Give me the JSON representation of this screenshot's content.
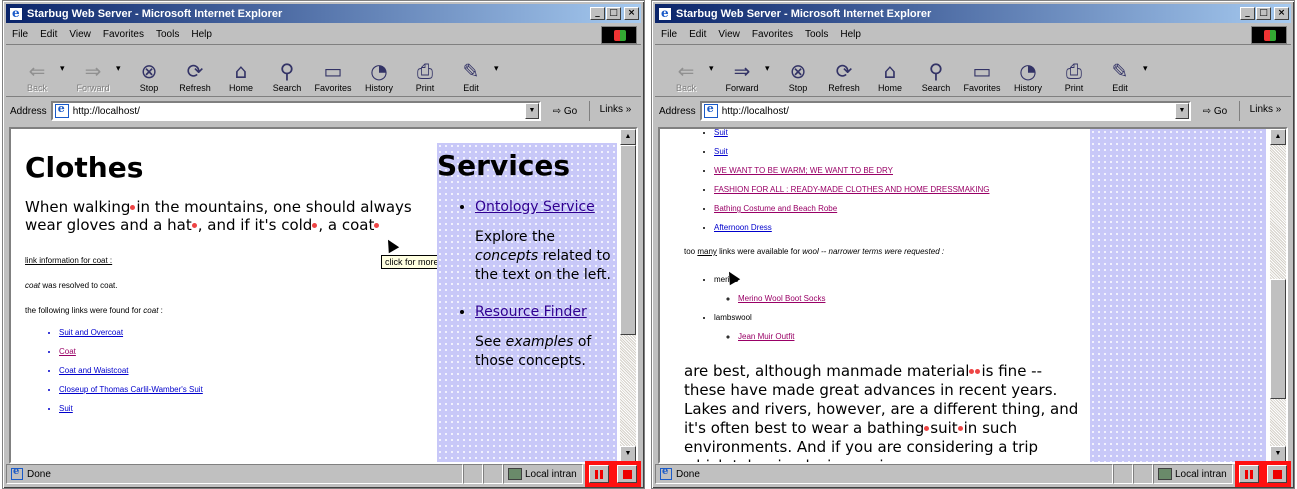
{
  "window": {
    "title": "Starbug Web Server - Microsoft Internet Explorer",
    "caption_min": "_",
    "caption_max": "□",
    "caption_close": "×"
  },
  "menu": [
    "File",
    "Edit",
    "View",
    "Favorites",
    "Tools",
    "Help"
  ],
  "toolbar": {
    "back": "Back",
    "forward": "Forward",
    "stop": "Stop",
    "refresh": "Refresh",
    "home": "Home",
    "search": "Search",
    "favorites": "Favorites",
    "history": "History",
    "print": "Print",
    "edit": "Edit"
  },
  "address": {
    "label": "Address",
    "url": "http://localhost/",
    "go": "Go",
    "links": "Links »"
  },
  "status": {
    "text": "Done",
    "zone": "Local intran"
  },
  "left_page": {
    "heading": "Clothes",
    "para_1": "When walking",
    "para_2": "in the mountains, one should always wear gloves and a hat",
    "para_3": ", and if it's cold",
    "para_4": ", a coat",
    "tooltip": "click for more info on 'coat'.",
    "info_heading": "link information for  coat :",
    "resolved_word": "coat",
    "resolved_text": " was resolved to  coat.",
    "found_prefix": "the following links were found for ",
    "found_word": "coat",
    "found_suffix": " :",
    "links": [
      "Suit and Overcoat",
      "Coat",
      "Coat and Waistcoat",
      "Closeup of Thomas Carlil-Wamber's Suit",
      "Suit"
    ],
    "services_heading": "Services",
    "service_1": "Ontology Service",
    "service_1_desc_a": "Explore the ",
    "service_1_desc_em": "concepts",
    "service_1_desc_b": " related to the text on the left.",
    "service_2": "Resource Finder",
    "service_2_desc_a": "See ",
    "service_2_desc_em": "examples",
    "service_2_desc_b": " of those concepts."
  },
  "right_page": {
    "links": [
      "Suit",
      "Suit",
      "WE WANT TO BE WARM; WE WANT TO BE DRY",
      "FASHION FOR ALL : READY-MADE CLOTHES AND HOME DRESSMAKING",
      "Bathing Costume and Beach Robe",
      "Afternoon Dress"
    ],
    "too_many_prefix": "too ",
    "too_many_word": "many",
    "too_many_mid": " links were available for ",
    "too_many_term": "wool",
    "too_many_suffix": " -- narrower terms were requested :",
    "wool_groups": [
      {
        "term": "merino",
        "link": "Merino Wool Boot Socks"
      },
      {
        "term": "lambswool",
        "link": "Jean Muir Outfit"
      }
    ],
    "para_1": "are best, although manmade material",
    "para_2": "is fine -- these have made great advances in recent years. Lakes and rivers, however, are a different thing, and it's often best to wear a bathing",
    "para_3": "suit",
    "para_4": "in such environments. And if you are considering a trip which takes in glaciers or ice"
  }
}
